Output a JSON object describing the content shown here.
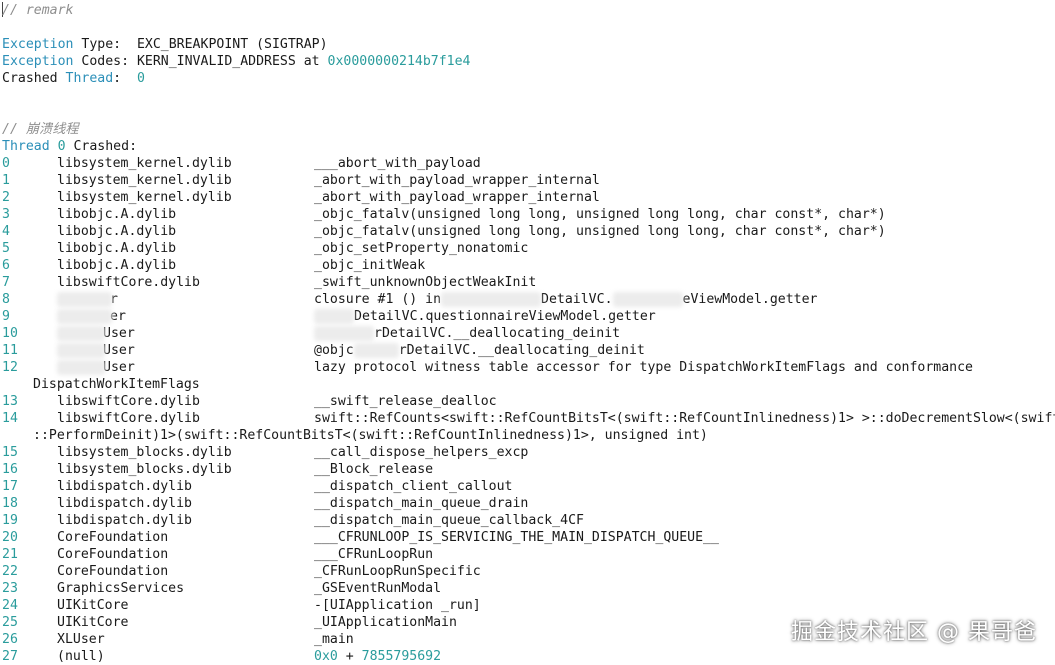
{
  "remark_comment": "// remark",
  "exception": {
    "type_label": "Exception",
    "type_rest": " Type:  EXC_BREAKPOINT (SIGTRAP)",
    "codes_label": "Exception",
    "codes_rest": " Codes: KERN_INVALID_ADDRESS at ",
    "codes_addr": "0x0000000214b7f1e4",
    "crashed_label": "Crashed ",
    "crashed_thread_kw": "Thread",
    "crashed_colon": ":  ",
    "crashed_value": "0"
  },
  "crash_comment": "// 崩溃线程",
  "thread_header": {
    "kw": "Thread",
    "num": "0",
    "rest": " Crashed:"
  },
  "frames": [
    {
      "n": "0",
      "module": "libsystem_kernel.dylib",
      "symbol": "___abort_with_payload"
    },
    {
      "n": "1",
      "module": "libsystem_kernel.dylib",
      "symbol": "_abort_with_payload_wrapper_internal"
    },
    {
      "n": "2",
      "module": "libsystem_kernel.dylib",
      "symbol": "_abort_with_payload_wrapper_internal"
    },
    {
      "n": "3",
      "module": "libobjc.A.dylib",
      "symbol": "_objc_fatalv(unsigned long long, unsigned long long, char const*, char*)"
    },
    {
      "n": "4",
      "module": "libobjc.A.dylib",
      "symbol": "_objc_fatalv(unsigned long long, unsigned long long, char const*, char*)"
    },
    {
      "n": "5",
      "module": "libobjc.A.dylib",
      "symbol": "_objc_setProperty_nonatomic"
    },
    {
      "n": "6",
      "module": "libobjc.A.dylib",
      "symbol": "_objc_initWeak"
    },
    {
      "n": "7",
      "module": "libswiftCore.dylib",
      "symbol": "_swift_unknownObjectWeakInit"
    },
    {
      "n": "8",
      "module": "r",
      "symbol_a": "closure #1 () in",
      "symbol_b": "DetailVC.",
      "symbol_c": "eViewModel.getter"
    },
    {
      "n": "9",
      "module": "er",
      "symbol_a": "",
      "symbol_b": "DetailVC.questionnaireViewModel.getter",
      "symbol_c": ""
    },
    {
      "n": "10",
      "module": "User",
      "symbol_a": "",
      "symbol_b": "rDetailVC.__deallocating_deinit",
      "symbol_c": ""
    },
    {
      "n": "11",
      "module": "User",
      "symbol_a": "@objc",
      "symbol_b": "rDetailVC.__deallocating_deinit",
      "symbol_c": ""
    },
    {
      "n": "12",
      "module": "User",
      "symbol": "lazy protocol witness table accessor for type DispatchWorkItemFlags and conformance",
      "wrap": "DispatchWorkItemFlags"
    },
    {
      "n": "13",
      "module": "libswiftCore.dylib",
      "symbol": "__swift_release_dealloc"
    },
    {
      "n": "14",
      "module": "libswiftCore.dylib",
      "symbol": "swift::RefCounts<swift::RefCountBitsT<(swift::RefCountInlinedness)1> >::doDecrementSlow<(swift",
      "wrap": "::PerformDeinit)1>(swift::RefCountBitsT<(swift::RefCountInlinedness)1>, unsigned int)"
    },
    {
      "n": "15",
      "module": "libsystem_blocks.dylib",
      "symbol": "__call_dispose_helpers_excp"
    },
    {
      "n": "16",
      "module": "libsystem_blocks.dylib",
      "symbol": "__Block_release"
    },
    {
      "n": "17",
      "module": "libdispatch.dylib",
      "symbol": "__dispatch_client_callout"
    },
    {
      "n": "18",
      "module": "libdispatch.dylib",
      "symbol": "__dispatch_main_queue_drain"
    },
    {
      "n": "19",
      "module": "libdispatch.dylib",
      "symbol": "__dispatch_main_queue_callback_4CF"
    },
    {
      "n": "20",
      "module": "CoreFoundation",
      "symbol": "___CFRUNLOOP_IS_SERVICING_THE_MAIN_DISPATCH_QUEUE__"
    },
    {
      "n": "21",
      "module": "CoreFoundation",
      "symbol": "___CFRunLoopRun"
    },
    {
      "n": "22",
      "module": "CoreFoundation",
      "symbol": "_CFRunLoopRunSpecific"
    },
    {
      "n": "23",
      "module": "GraphicsServices",
      "symbol": "_GSEventRunModal"
    },
    {
      "n": "24",
      "module": "UIKitCore",
      "symbol": "-[UIApplication _run]"
    },
    {
      "n": "25",
      "module": "UIKitCore",
      "symbol": "_UIApplicationMain"
    },
    {
      "n": "26",
      "module": "XLUser",
      "symbol": "_main"
    },
    {
      "n": "27",
      "module": "(null)",
      "symbol_addr": "0x0",
      "symbol_plus": " + ",
      "symbol_num": "7855795692"
    }
  ],
  "watermark": "掘金技术社区 @ 果哥爸",
  "colors": {
    "keyword": "#2b8fb8",
    "number": "#2a9c9c",
    "comment": "#8e8e8e"
  }
}
